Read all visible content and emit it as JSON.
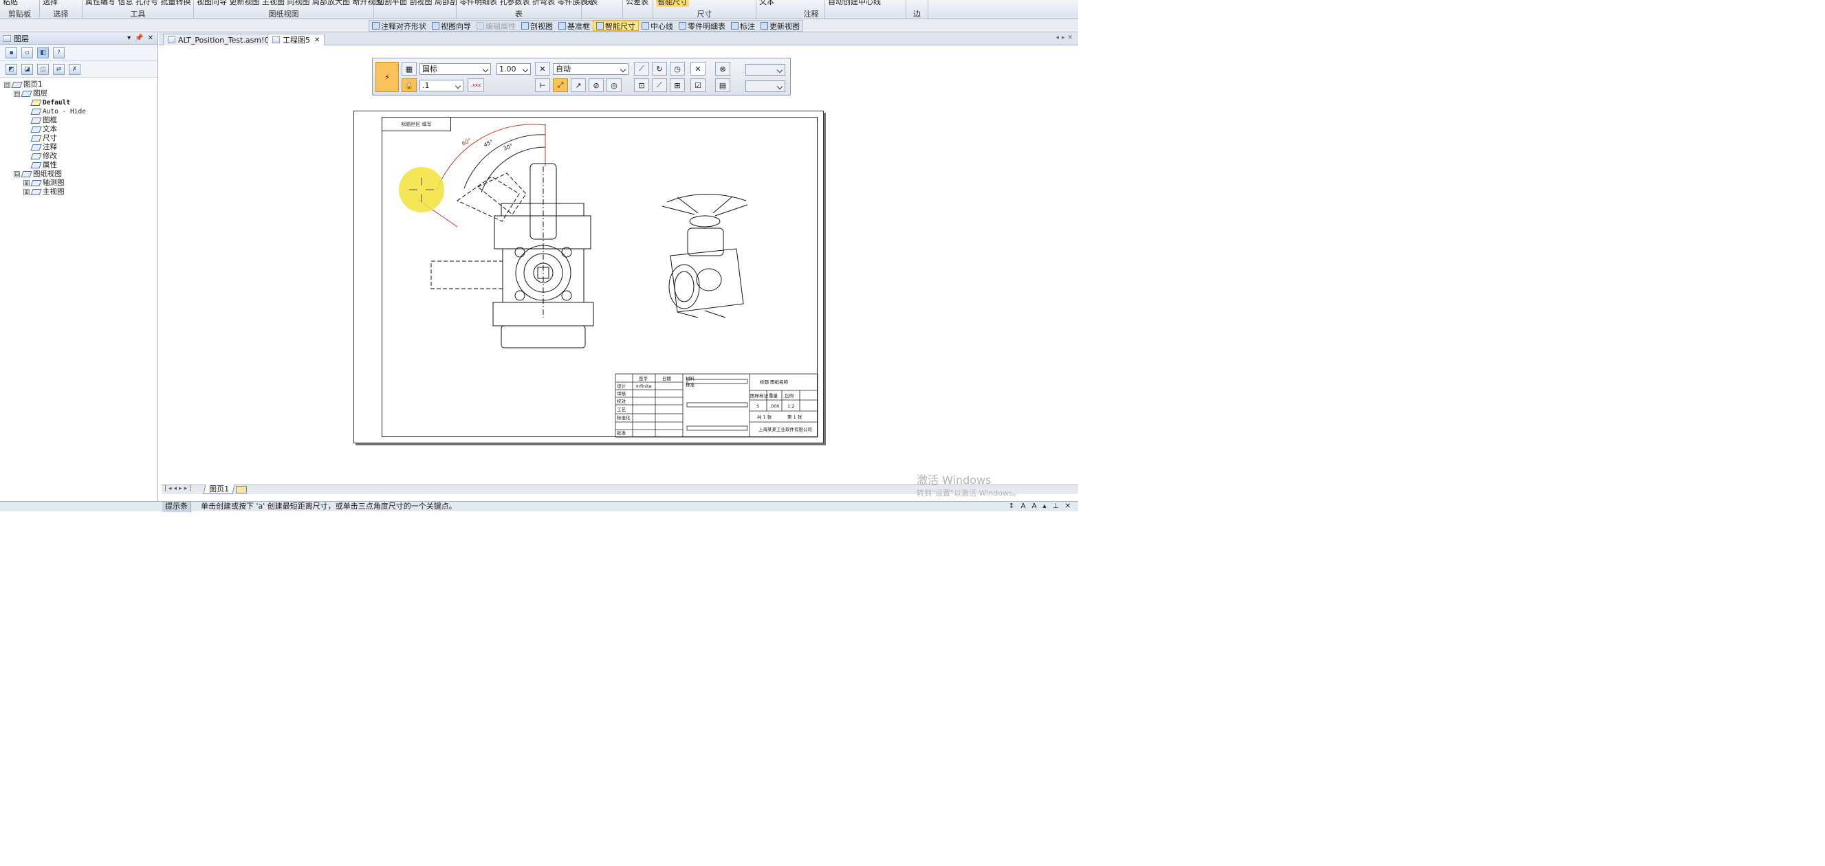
{
  "ribbon": {
    "groups": [
      {
        "top": "粘贴",
        "caption": "剪贴板"
      },
      {
        "top": "选择",
        "caption": "选择"
      },
      {
        "top": "属性编写  信息  孔符号  批量转换",
        "caption": "工具"
      },
      {
        "top": "视图向导  更新视图  主视图  向视图  局部放大图  断开视图",
        "caption": "图纸视图"
      },
      {
        "top": "切割平面  剖视图  局部剖",
        "caption": ""
      },
      {
        "top": "零件明细表  孔参数表  折弯表  零件族表  表",
        "caption": "表"
      },
      {
        "top": "块",
        "caption": ""
      },
      {
        "top": "公差表",
        "caption": ""
      },
      {
        "top": "智能尺寸",
        "caption": "尺寸"
      },
      {
        "top": "文本",
        "caption": "注释"
      },
      {
        "top": "自动创建中心线",
        "caption": ""
      },
      {
        "top": "",
        "caption": "边"
      }
    ]
  },
  "command_bar": {
    "items": [
      {
        "label": "注释对齐形状",
        "state": "normal"
      },
      {
        "label": "视图向导",
        "state": "normal"
      },
      {
        "label": "编辑属性",
        "state": "disabled"
      },
      {
        "label": "剖视图",
        "state": "normal"
      },
      {
        "label": "基准框",
        "state": "normal"
      },
      {
        "label": "智能尺寸",
        "state": "active"
      },
      {
        "label": "中心线",
        "state": "normal"
      },
      {
        "label": "零件明细表",
        "state": "normal"
      },
      {
        "label": "标注",
        "state": "normal"
      },
      {
        "label": "更新视图",
        "state": "normal"
      }
    ]
  },
  "left_panel": {
    "title": "图层",
    "tree": [
      {
        "label": "图页1",
        "level": 0,
        "expander": "⊟",
        "style": "normal"
      },
      {
        "label": "图层",
        "level": 1,
        "expander": "⊟",
        "style": "normal"
      },
      {
        "label": "Default",
        "level": 2,
        "expander": "",
        "style": "bold-mono"
      },
      {
        "label": "Auto - Hide",
        "level": 2,
        "expander": "",
        "style": "mono"
      },
      {
        "label": "图框",
        "level": 2,
        "expander": "",
        "style": "normal"
      },
      {
        "label": "文本",
        "level": 2,
        "expander": "",
        "style": "normal"
      },
      {
        "label": "尺寸",
        "level": 2,
        "expander": "",
        "style": "normal"
      },
      {
        "label": "注释",
        "level": 2,
        "expander": "",
        "style": "normal"
      },
      {
        "label": "修改",
        "level": 2,
        "expander": "",
        "style": "normal"
      },
      {
        "label": "属性",
        "level": 2,
        "expander": "",
        "style": "normal"
      },
      {
        "label": "图纸视图",
        "level": 1,
        "expander": "⊟",
        "style": "normal"
      },
      {
        "label": "轴测图",
        "level": 2,
        "expander": "⊞",
        "style": "normal"
      },
      {
        "label": "主视图",
        "level": 2,
        "expander": "⊞",
        "style": "normal"
      }
    ]
  },
  "doc_tabs": [
    {
      "label": "ALT_Position_Test.asm!0",
      "active": false
    },
    {
      "label": "工程图5",
      "active": true
    }
  ],
  "formatting_toolbar": {
    "standard": "国标",
    "scale": "1.00",
    "mode": "自动",
    "precision": ".1",
    "disabled_field_1": "",
    "disabled_field_2": ""
  },
  "drawing": {
    "title_block_label": "标题栏区 填写",
    "angle_labels": [
      "60°",
      "45°",
      "30°"
    ],
    "tb_headers": [
      "签字",
      "日期",
      "材料",
      "标准",
      "设计",
      "审核",
      "校对",
      "工艺",
      "标准化",
      "批准",
      "图样标记",
      "重量",
      "比例"
    ],
    "tb_designer": "Infinite",
    "tb_values": [
      "S",
      ".000",
      "1:2"
    ],
    "tb_sheet": [
      "共 1 张",
      "第 1 张"
    ],
    "tb_company": "上海某某工业软件有限公司",
    "tb_title": "标题 图纸名称"
  },
  "sheet_tabs": {
    "active": "图页1"
  },
  "status_bar": {
    "label": "提示条",
    "text": "单击创建或按下 'a' 创建最短距离尺寸，或单击三点角度尺寸的一个关键点。"
  },
  "watermark": {
    "line1": "激活 Windows",
    "line2": "转到\"设置\"以激活 Windows。"
  }
}
